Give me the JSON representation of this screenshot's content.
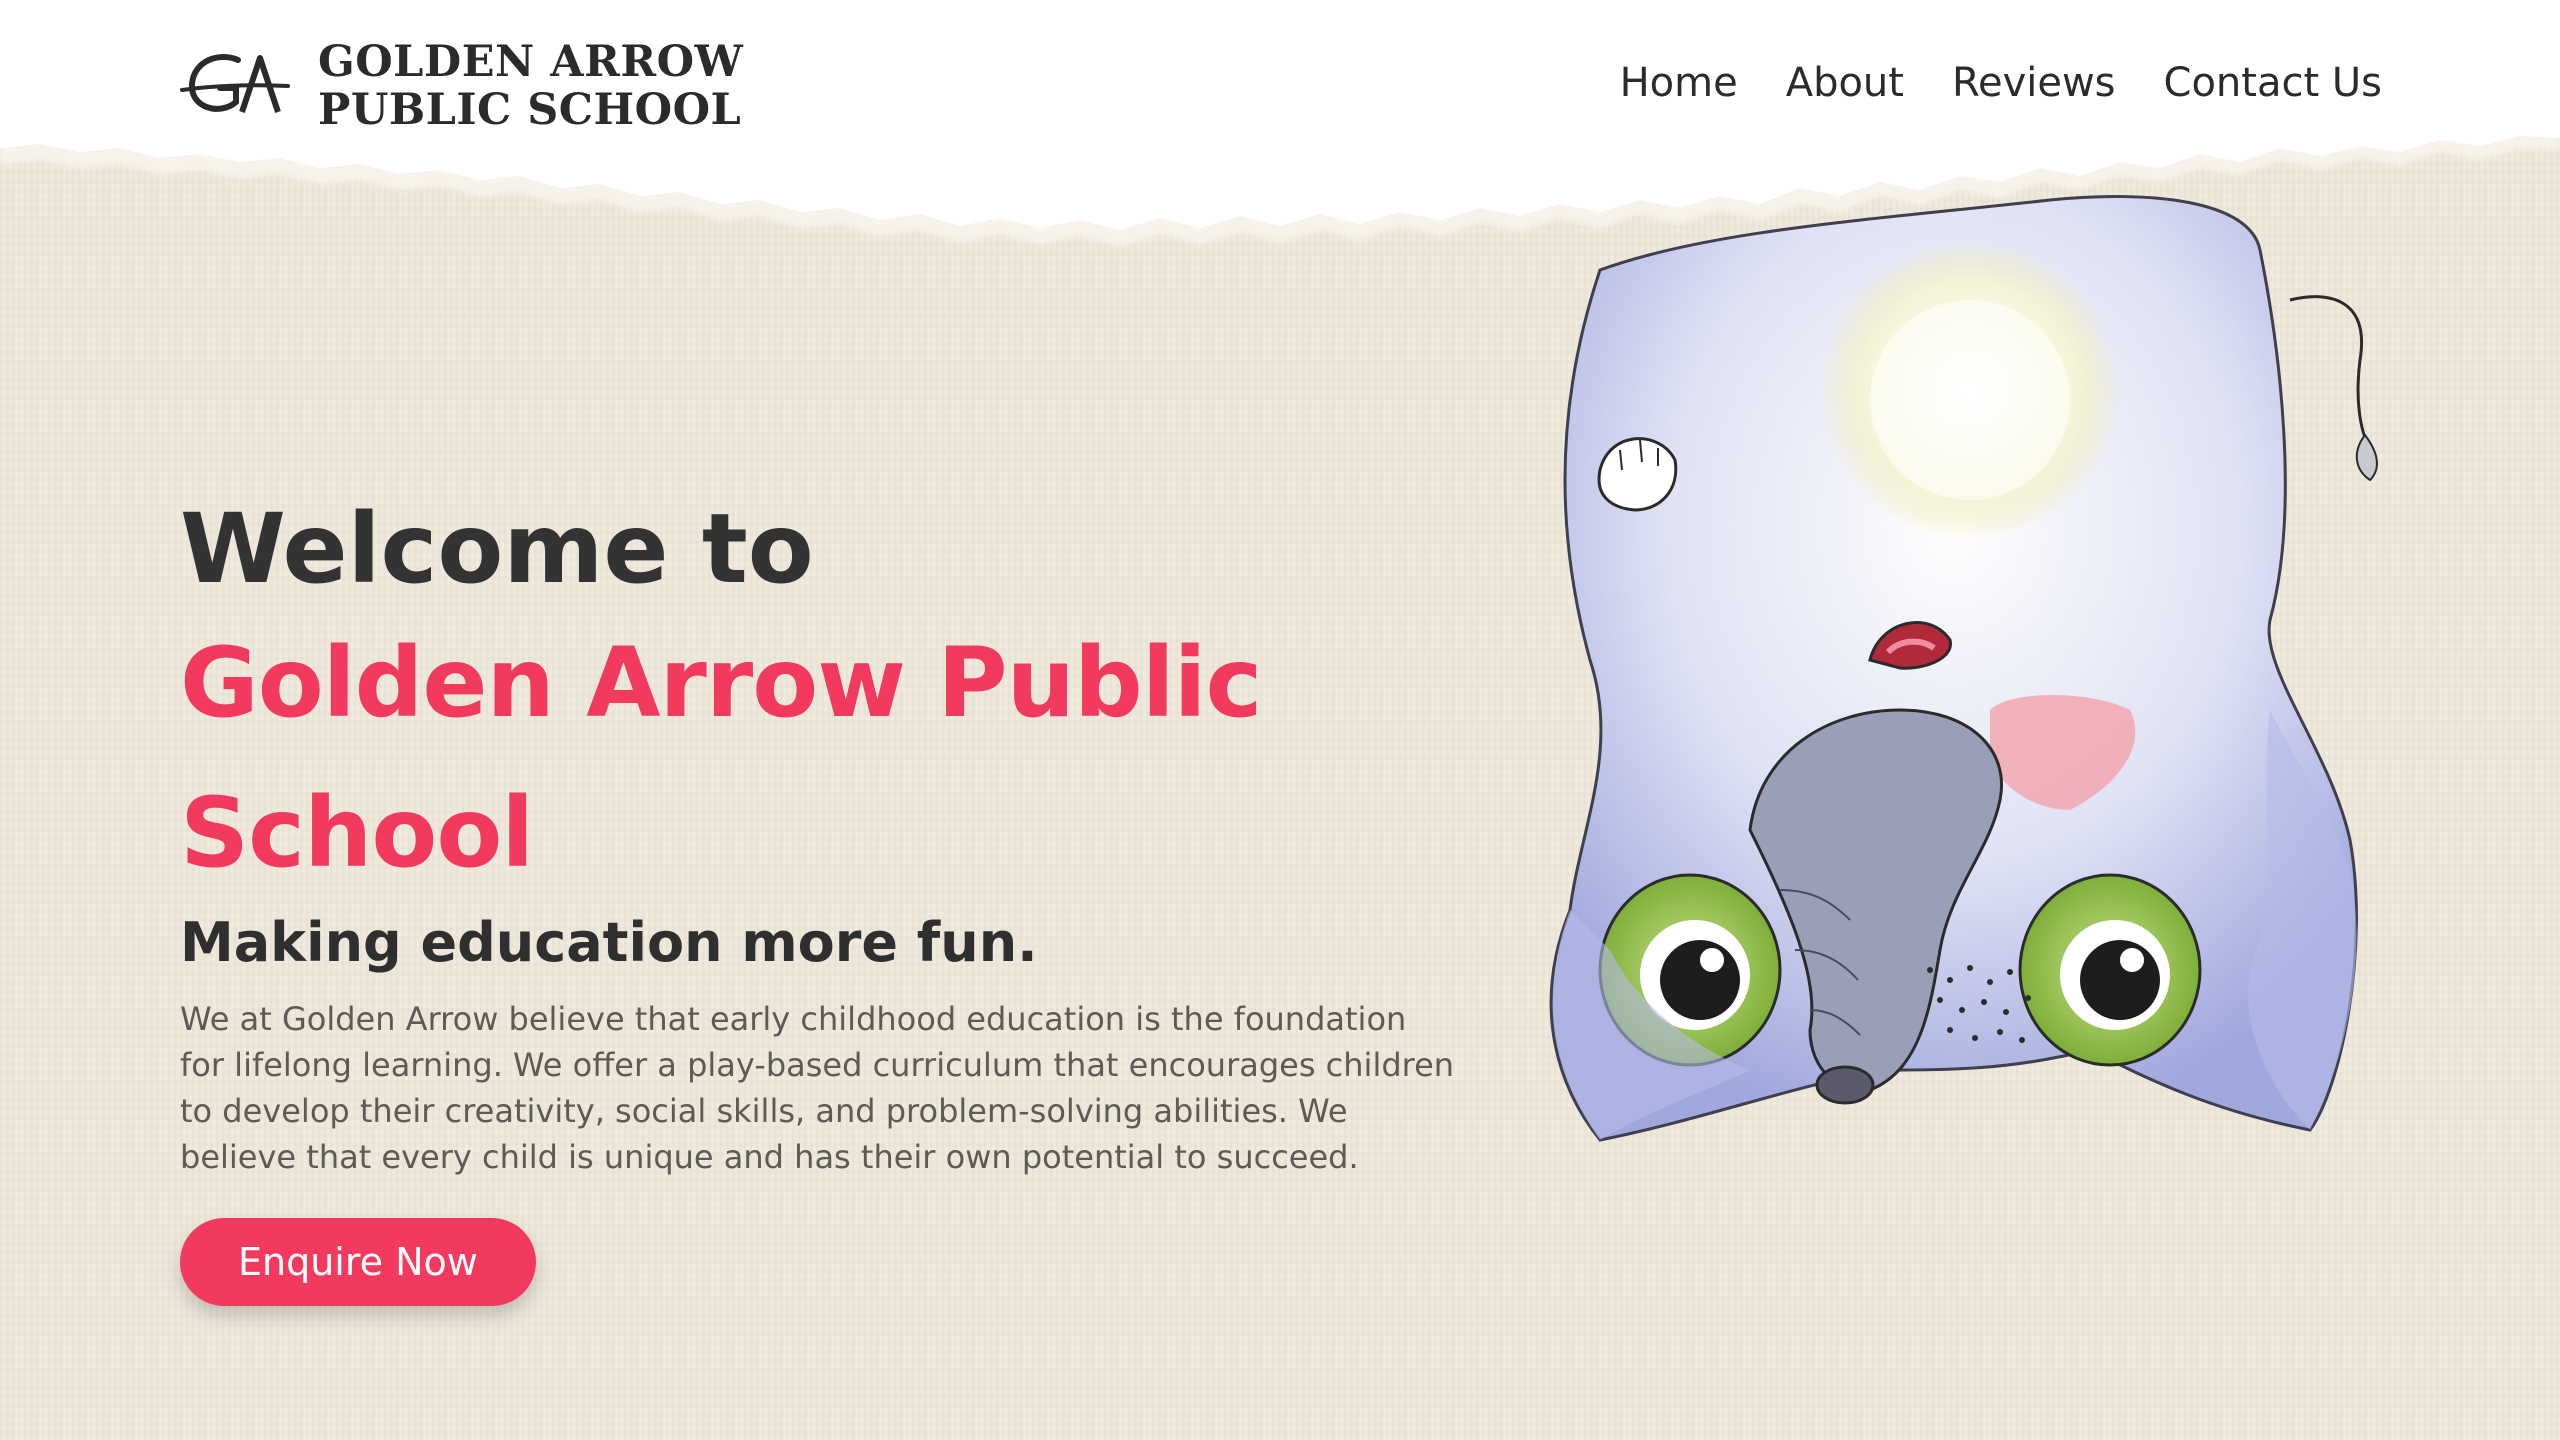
{
  "brand": {
    "logo_letters": "GA",
    "name_line1": "GOLDEN ARROW",
    "name_line2": "PUBLIC SCHOOL"
  },
  "nav": {
    "items": [
      {
        "label": "Home"
      },
      {
        "label": "About"
      },
      {
        "label": "Reviews"
      },
      {
        "label": "Contact Us"
      }
    ]
  },
  "hero": {
    "title_line1": "Welcome to",
    "title_line2": "Golden Arrow Public School",
    "tagline": "Making education more fun.",
    "description": "We at Golden Arrow believe that early childhood education is the foundation for lifelong learning. We offer a play-based curriculum that encourages children to develop their creativity, social skills, and problem-solving abilities. We believe that every child is unique and has their own potential to succeed.",
    "cta_label": "Enquire Now"
  },
  "colors": {
    "accent": "#f23a5e",
    "background": "#efe9dc",
    "text_dark": "#333333",
    "text_muted": "#5e5a55"
  },
  "illustration": {
    "subject": "upside-down-elephant-watercolor"
  }
}
